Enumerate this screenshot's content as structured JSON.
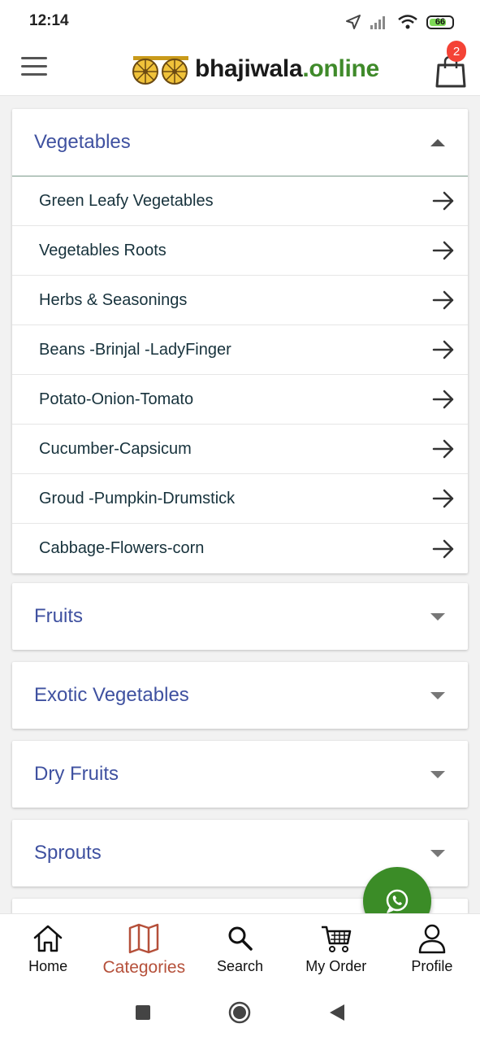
{
  "status_bar": {
    "time": "12:14",
    "battery": "66"
  },
  "header": {
    "logo_main": "bhajiwala",
    "logo_suffix": ".online",
    "cart_count": "2"
  },
  "categories": [
    {
      "title": "Vegetables",
      "expanded": true,
      "items": [
        "Green Leafy Vegetables",
        "Vegetables Roots",
        "Herbs & Seasonings",
        "Beans -Brinjal -LadyFinger",
        "Potato-Onion-Tomato",
        "Cucumber-Capsicum",
        "Groud -Pumpkin-Drumstick",
        "Cabbage-Flowers-corn"
      ]
    },
    {
      "title": "Fruits",
      "expanded": false
    },
    {
      "title": "Exotic Vegetables",
      "expanded": false
    },
    {
      "title": "Dry Fruits",
      "expanded": false
    },
    {
      "title": "Sprouts",
      "expanded": false
    }
  ],
  "bottom_nav": [
    {
      "label": "Home",
      "icon": "home-icon"
    },
    {
      "label": "Categories",
      "icon": "map-icon",
      "active": true
    },
    {
      "label": "Search",
      "icon": "search-icon"
    },
    {
      "label": "My Order",
      "icon": "cart-icon"
    },
    {
      "label": "Profile",
      "icon": "profile-icon"
    }
  ],
  "colors": {
    "category_title": "#3f51a0",
    "active_nav": "#b5503a",
    "fab": "#3b8c27",
    "badge": "#f44336"
  }
}
